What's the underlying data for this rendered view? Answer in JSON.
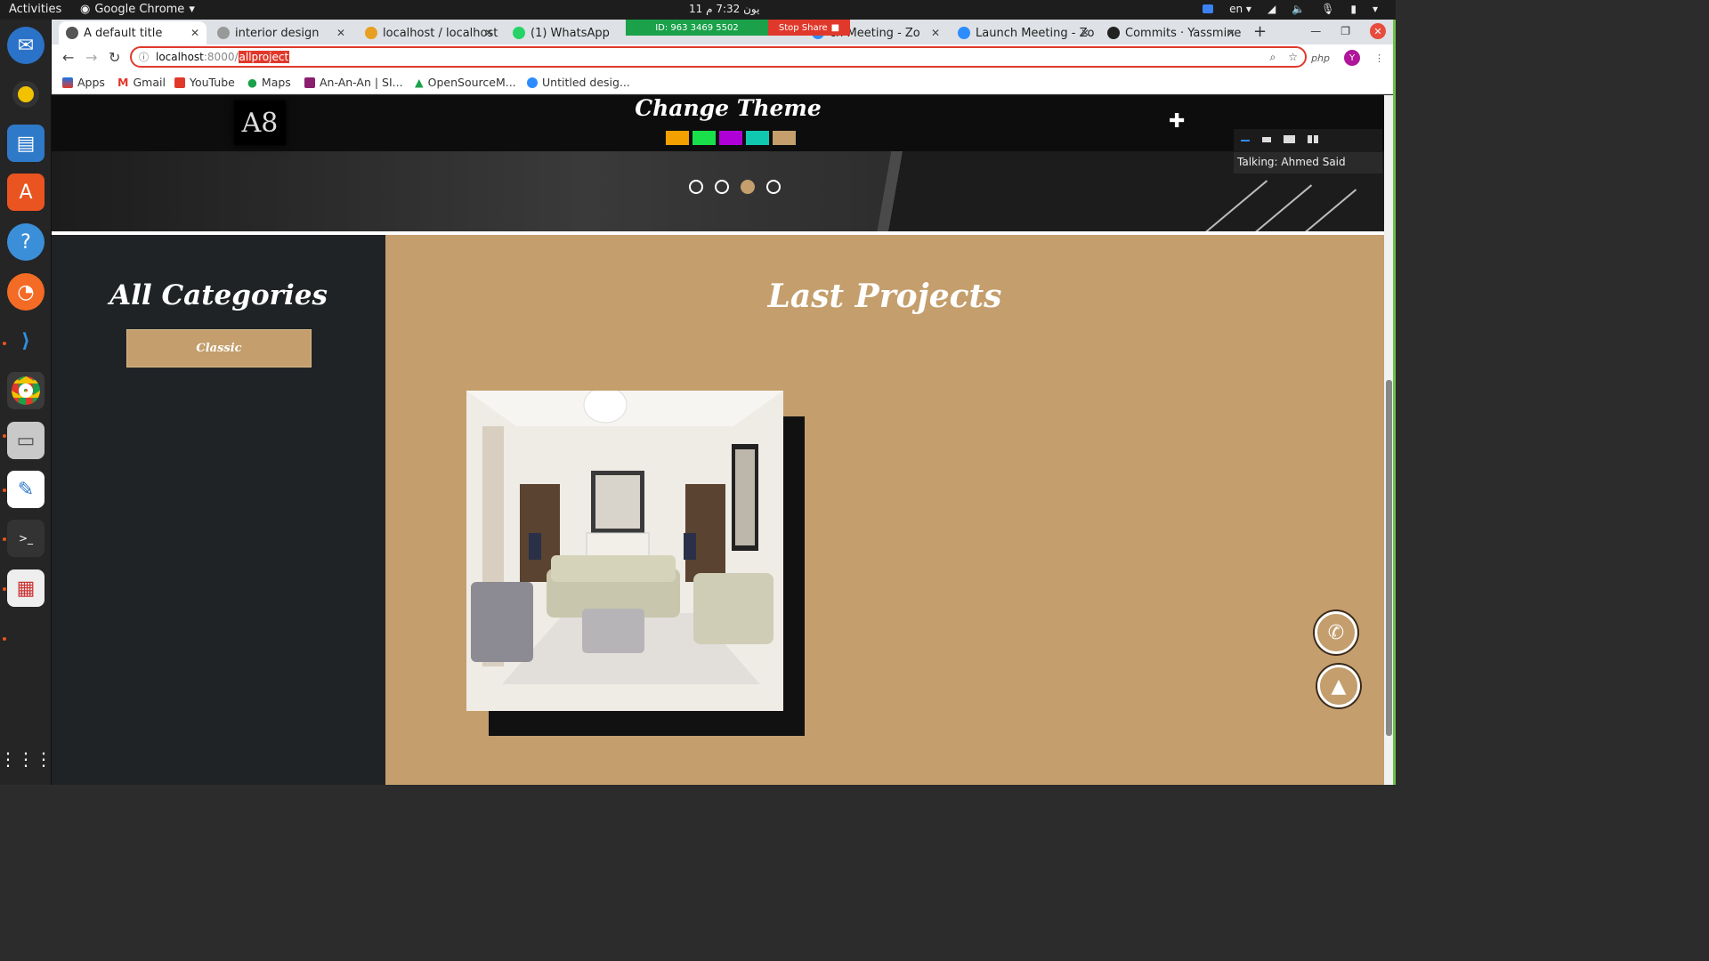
{
  "os": {
    "activities": "Activities",
    "app_name": "Google Chrome",
    "clock": "11 يون  7:32 م",
    "lang": "en"
  },
  "browser": {
    "tabs": [
      {
        "label": "A default title",
        "active": true
      },
      {
        "label": "interior design"
      },
      {
        "label": "localhost / localhost"
      },
      {
        "label": "(1) WhatsApp"
      },
      {
        "label": "ch Meeting - Zo"
      },
      {
        "label": "Launch Meeting - Zo"
      },
      {
        "label": "Commits · Yassmine"
      }
    ],
    "zoom_share": {
      "id": "ID: 963 3469 5502",
      "stop": "Stop Share"
    },
    "url": {
      "host": "localhost",
      "port": ":8000/",
      "path": "allproject"
    },
    "bookmarks": [
      "Apps",
      "Gmail",
      "YouTube",
      "Maps",
      "An-An-An | SI...",
      "OpenSourceM...",
      "Untitled desig..."
    ],
    "extension_label": "php",
    "profile_initial": "Y"
  },
  "zoom_panel": {
    "talking": "Talking: Ahmed Said"
  },
  "page": {
    "logo_text": "A8",
    "theme_title": "Change Theme",
    "theme_colors": [
      "#f4a000",
      "#19e04a",
      "#b000d8",
      "#10c8b0",
      "#c49e6c"
    ],
    "slider_active_index": 2,
    "sidebar_title": "All Categories",
    "categories": [
      "Classic"
    ],
    "main_title": "Last Projects"
  },
  "colors": {
    "accent": "#c49e6c",
    "dark": "#1f2326"
  }
}
